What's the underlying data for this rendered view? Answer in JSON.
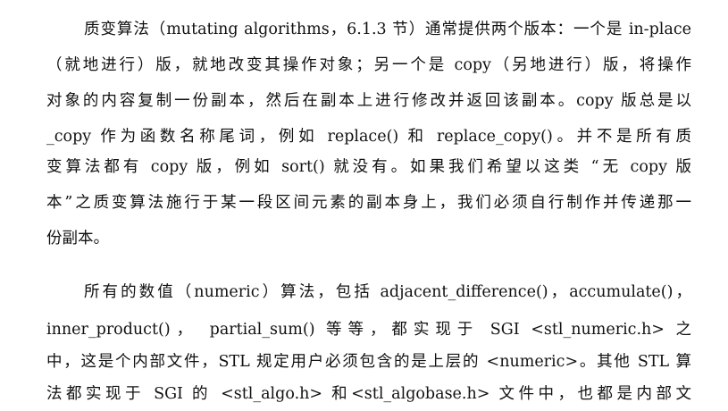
{
  "document": {
    "paragraph1": {
      "lines": [
        "质变算法（mutating algorithms，6.1.3 节）通常提供两个版本：一个是 in-place",
        "（就地进行）版，就地改变其操作对象；另一个是 copy（另地进行）版，将操作",
        "对象的内容复制一份副本，然后在副本上进行修改并返回该副本。copy 版总是以",
        "_copy 作为函数名称尾词，例如 replace() 和 replace_copy()。并不是所有质",
        "变算法都有 copy 版，例如 sort() 就没有。如果我们希望以这类 “无 copy 版",
        "本”之质变算法施行于某一段区间元素的副本身上，我们必须自行制作并传递那一",
        "份副本。"
      ]
    },
    "paragraph2": {
      "lines": [
        "所有的数值（numeric）算法，包括 adjacent_difference()，accumulate()，",
        "inner_product()， partial_sum() 等等，都实现于 SGI <stl_numeric.h> 之",
        "中，这是个内部文件，STL 规定用户必须包含的是上层的 <numeric>。其他 STL 算",
        "法都实现于 SGI 的 <stl_algo.h> 和<stl_algobase.h> 文件中，也都是内部文"
      ]
    }
  }
}
